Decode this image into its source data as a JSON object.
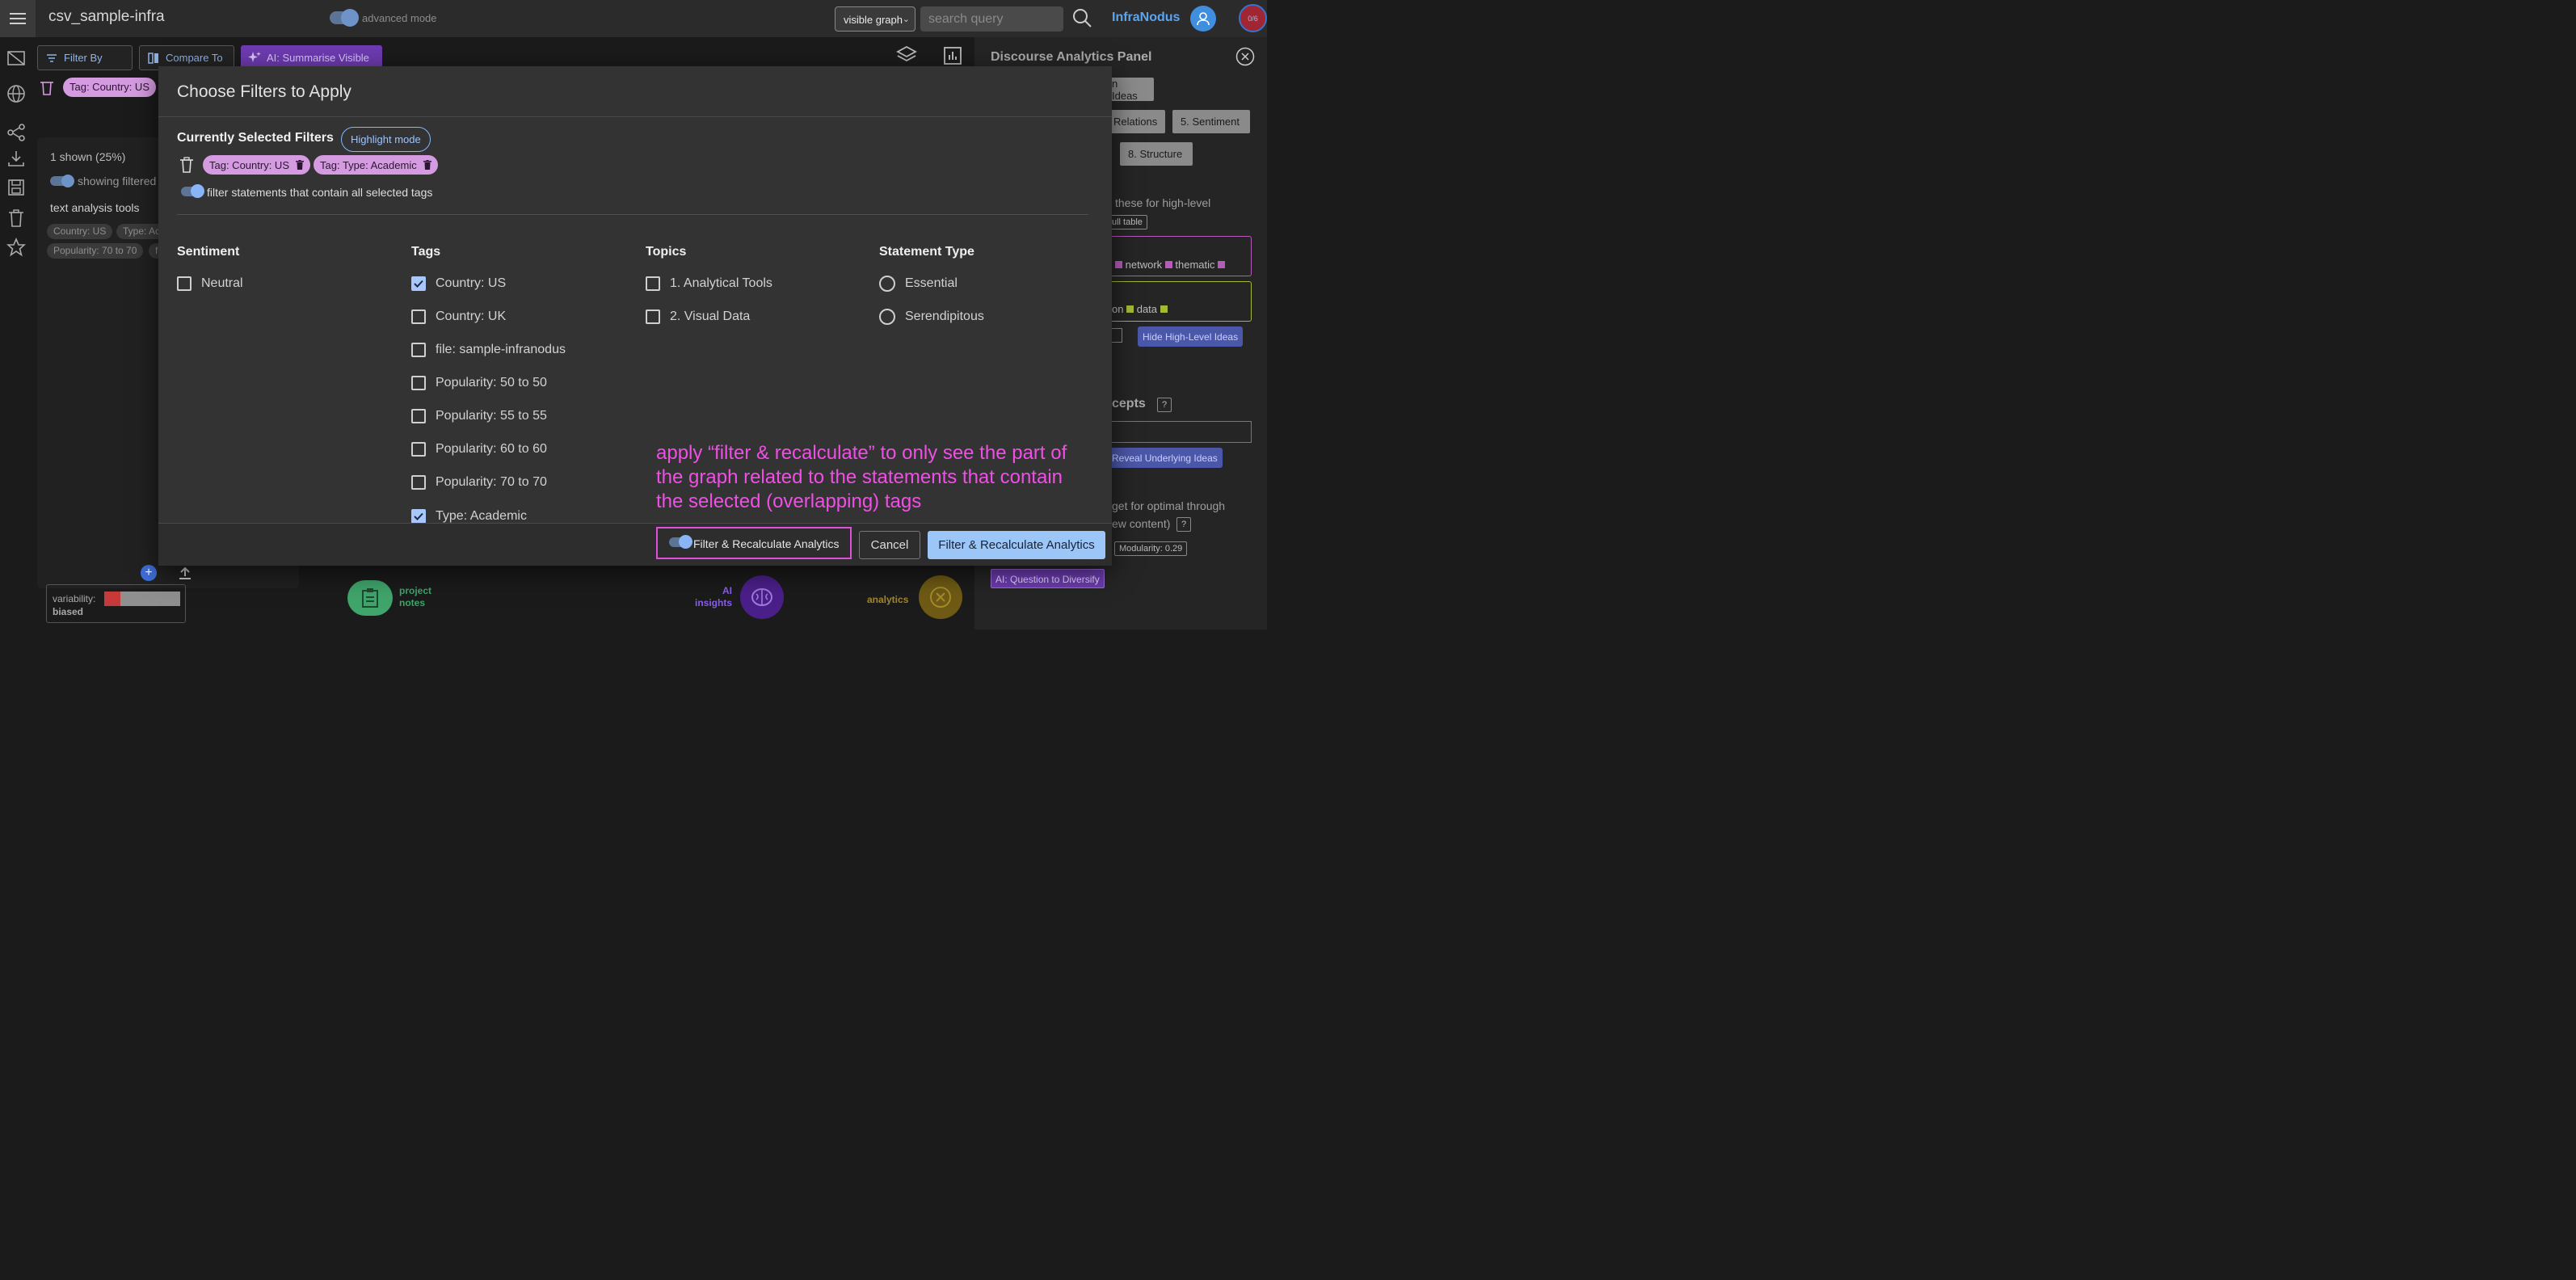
{
  "app": {
    "title": "csv_sample-infra",
    "advanced_mode_label": "advanced mode",
    "brand": "InfraNodus",
    "counter": "0/6"
  },
  "header": {
    "view_select_value": "visible graph",
    "search_placeholder": "search query"
  },
  "toolbar": {
    "filter_by": "Filter By",
    "compare_to": "Compare To",
    "ai_summarise": "AI: Summarise Visible",
    "active_tag": "Tag: Country: US"
  },
  "bg_panel": {
    "shown": "1 shown (25%)",
    "showing_filtered": "showing filtered",
    "heading": "text analysis tools",
    "chips": [
      "Country: US",
      "Type: Ac",
      "Popularity: 70 to 70",
      "fi"
    ],
    "variability_label": "variability:",
    "variability_value": "biased"
  },
  "right_panel": {
    "title": "Discourse Analytics Panel",
    "buttons": [
      "n Ideas",
      "Relations",
      "5. Sentiment",
      "8. Structure"
    ],
    "text_high_level": "these for high-level",
    "full_table": "ull table",
    "words_1": [
      "network",
      "thematic"
    ],
    "words_2": [
      "on",
      "data"
    ],
    "hide_high_level": "Hide High-Level Ideas",
    "concepts": "cepts",
    "help": "?",
    "reveal": "Reveal Underlying Ideas",
    "optimal_1": "get for optimal through",
    "optimal_2": "ew content)",
    "modularity": "Modularity: 0.29",
    "question": "AI: Question to Diversify"
  },
  "modal": {
    "title": "Choose Filters to Apply",
    "current_label": "Currently Selected Filters",
    "highlight_mode": "Highlight mode",
    "selected_tags": [
      "Tag: Country: US",
      "Tag: Type: Academic"
    ],
    "filter_all_label": "filter statements that contain all selected tags",
    "columns": {
      "sentiment": {
        "title": "Sentiment",
        "options": [
          {
            "label": "Neutral",
            "checked": false
          }
        ]
      },
      "tags": {
        "title": "Tags",
        "options": [
          {
            "label": "Country: US",
            "checked": true
          },
          {
            "label": "Country: UK",
            "checked": false
          },
          {
            "label": "file: sample-infranodus",
            "checked": false
          },
          {
            "label": "Popularity: 50 to 50",
            "checked": false
          },
          {
            "label": "Popularity: 55 to 55",
            "checked": false
          },
          {
            "label": "Popularity: 60 to 60",
            "checked": false
          },
          {
            "label": "Popularity: 70 to 70",
            "checked": false
          },
          {
            "label": "Type: Academic",
            "checked": true
          }
        ]
      },
      "topics": {
        "title": "Topics",
        "options": [
          {
            "label": "1. Analytical Tools",
            "checked": false
          },
          {
            "label": "2. Visual Data",
            "checked": false
          }
        ]
      },
      "statement_type": {
        "title": "Statement Type",
        "options": [
          {
            "label": "Essential",
            "checked": false
          },
          {
            "label": "Serendipitous",
            "checked": false
          }
        ]
      }
    },
    "annotation": "apply “filter & recalculate” to only see the part of the graph related to the statements that contain the selected (overlapping) tags",
    "recalc_toggle_label": "Filter & Recalculate Analytics",
    "cancel": "Cancel",
    "apply": "Filter & Recalculate Analytics"
  },
  "bottom": {
    "project_notes": [
      "project",
      "notes"
    ],
    "ai_insights": [
      "AI",
      "insights"
    ],
    "analytics": "analytics"
  },
  "colors": {
    "accent_blue": "#9cc6f7",
    "tag_chip": "#d59be0",
    "annotation": "#f04fe6",
    "brand": "#5ba6ef"
  }
}
